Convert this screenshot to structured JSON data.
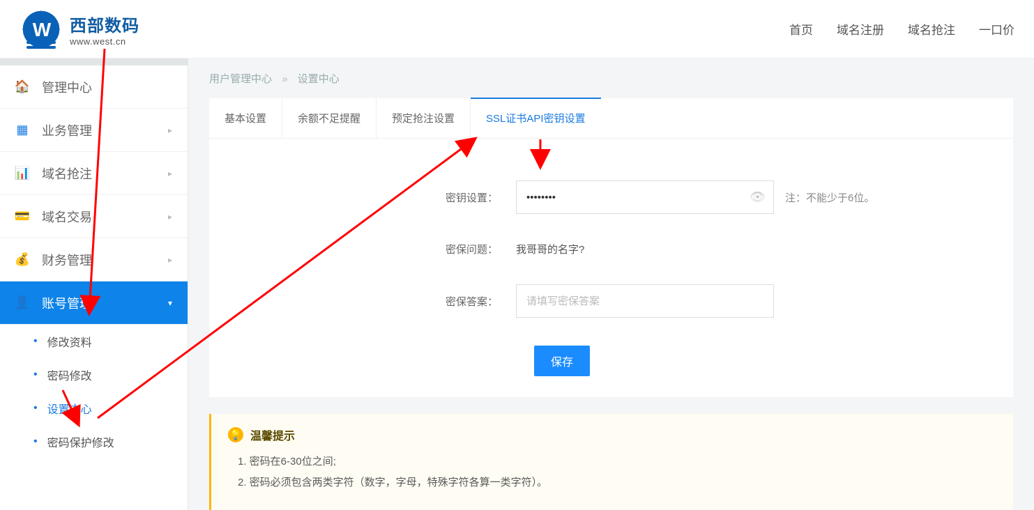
{
  "brand": {
    "name_cn": "西部数码",
    "name_en": "www.west.cn"
  },
  "topnav": [
    "首页",
    "域名注册",
    "域名抢注",
    "一口价"
  ],
  "sidebar": {
    "items": [
      {
        "label": "管理中心",
        "icon": "home"
      },
      {
        "label": "业务管理",
        "icon": "grid",
        "expandable": true
      },
      {
        "label": "域名抢注",
        "icon": "bars",
        "expandable": true
      },
      {
        "label": "域名交易",
        "icon": "card",
        "expandable": true
      },
      {
        "label": "财务管理",
        "icon": "wallet",
        "expandable": true
      },
      {
        "label": "账号管理",
        "icon": "idcard",
        "expandable": true,
        "active": true
      }
    ],
    "subitems": [
      {
        "label": "修改资料"
      },
      {
        "label": "密码修改"
      },
      {
        "label": "设置中心",
        "current": true
      },
      {
        "label": "密码保护修改"
      }
    ]
  },
  "breadcrumb": {
    "a": "用户管理中心",
    "b": "设置中心"
  },
  "tabs": [
    "基本设置",
    "余额不足提醒",
    "预定抢注设置",
    "SSL证书API密钥设置"
  ],
  "active_tab_index": 3,
  "form": {
    "key_label": "密钥设置：",
    "key_value": "••••••••",
    "key_hint": "注：不能少于6位。",
    "question_label": "密保问题：",
    "question_value": "我哥哥的名字?",
    "answer_label": "密保答案：",
    "answer_placeholder": "请填写密保答案",
    "save_label": "保存"
  },
  "tip": {
    "title": "温馨提示",
    "items": [
      "1. 密码在6-30位之间;",
      "2. 密码必须包含两类字符（数字，字母，特殊字符各算一类字符）。"
    ]
  }
}
